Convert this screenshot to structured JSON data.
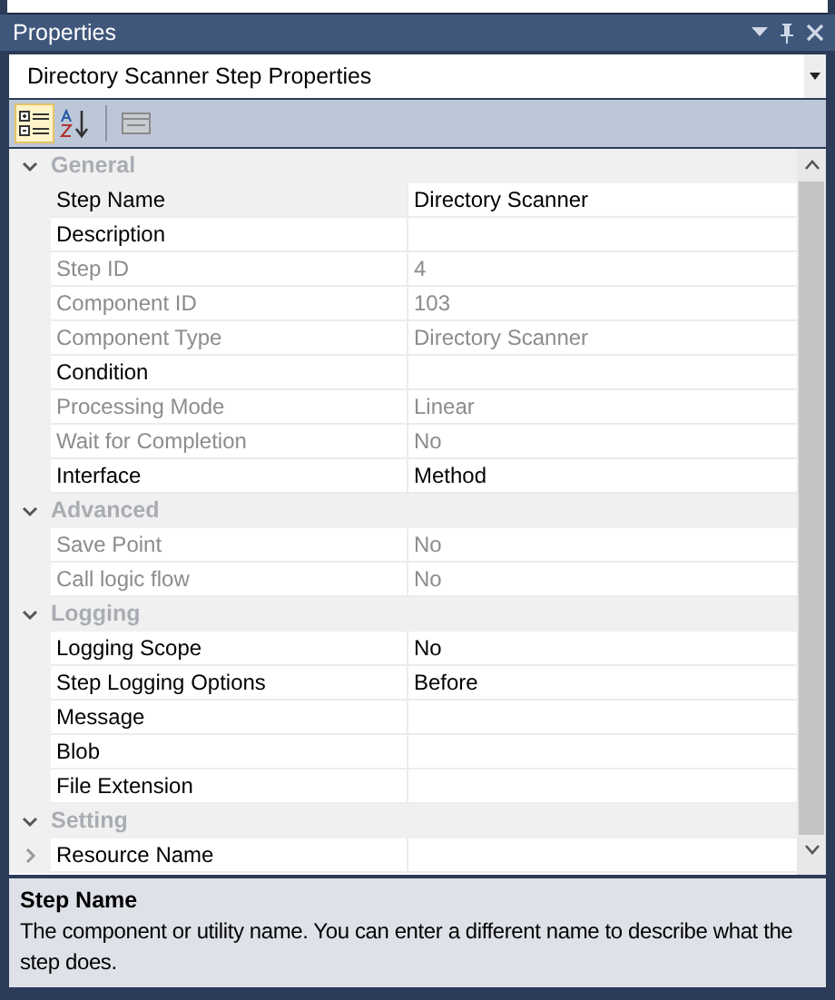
{
  "panel": {
    "title": "Properties"
  },
  "object_selector": {
    "value": "Directory Scanner Step Properties"
  },
  "toolbar": [
    {
      "kind": "categorized",
      "selected": true,
      "disabled": false
    },
    {
      "kind": "alphabetical",
      "selected": false,
      "disabled": false
    },
    {
      "kind": "property-pages",
      "selected": false,
      "disabled": true
    }
  ],
  "categories": [
    {
      "name": "General",
      "expanded": true,
      "properties": [
        {
          "name": "Step Name",
          "value": "Directory Scanner",
          "disabled": false,
          "selected": true
        },
        {
          "name": "Description",
          "disabled": false,
          "selected": false
        },
        {
          "name": "Step ID",
          "value": "4",
          "disabled": true,
          "selected": false
        },
        {
          "name": "Component ID",
          "value": "103",
          "disabled": true,
          "selected": false
        },
        {
          "name": "Component Type",
          "value": "Directory Scanner",
          "disabled": true,
          "selected": false
        },
        {
          "name": "Condition",
          "disabled": false,
          "selected": false
        },
        {
          "name": "Processing Mode",
          "value": "Linear",
          "disabled": true,
          "selected": false
        },
        {
          "name": "Wait for Completion",
          "value": "No",
          "disabled": true,
          "selected": false
        },
        {
          "name": "Interface",
          "value": "Method",
          "disabled": false,
          "selected": false
        }
      ]
    },
    {
      "name": "Advanced",
      "expanded": true,
      "properties": [
        {
          "name": "Save Point",
          "value": "No",
          "disabled": true,
          "selected": false
        },
        {
          "name": "Call logic flow",
          "value": "No",
          "disabled": true,
          "selected": false
        }
      ]
    },
    {
      "name": "Logging",
      "expanded": true,
      "properties": [
        {
          "name": "Logging Scope",
          "value": "No",
          "disabled": false,
          "selected": false
        },
        {
          "name": "Step Logging Options",
          "value": "Before",
          "disabled": false,
          "selected": false
        },
        {
          "name": "Message",
          "disabled": false,
          "selected": false
        },
        {
          "name": "Blob",
          "disabled": false,
          "selected": false
        },
        {
          "name": "File Extension",
          "disabled": false,
          "selected": false
        }
      ]
    },
    {
      "name": "Setting",
      "expanded": true,
      "properties": [
        {
          "name": "Resource Name",
          "disabled": false,
          "selected": false,
          "expanded": false
        }
      ]
    }
  ],
  "description": {
    "title": "Step Name",
    "text": "The component or utility name. You can enter a different name to describe what the step does."
  }
}
